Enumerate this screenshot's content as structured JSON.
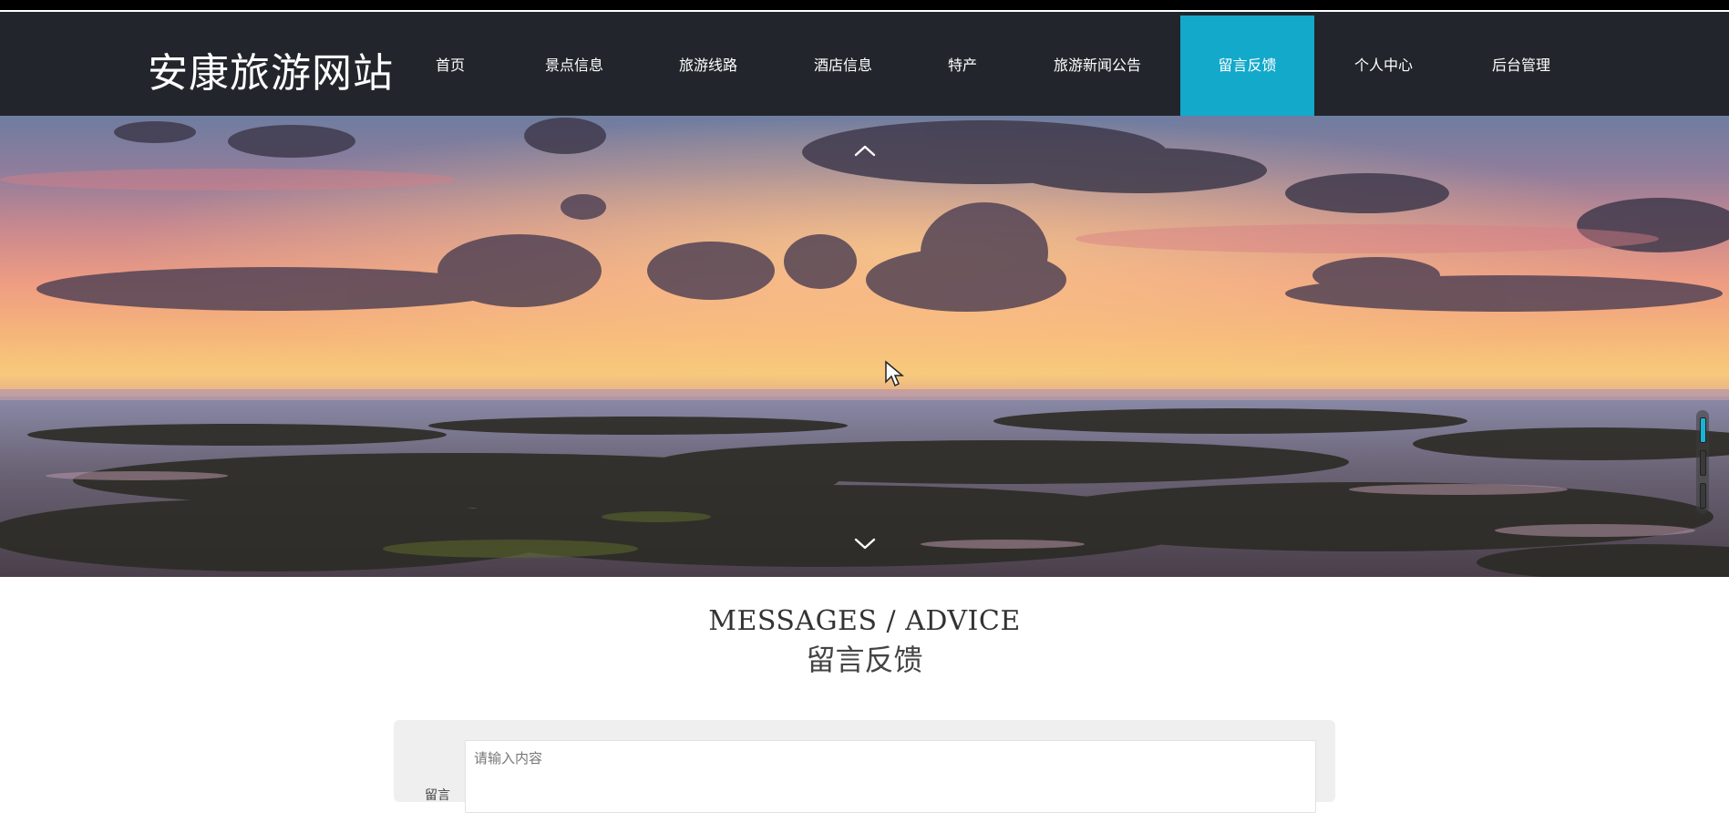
{
  "header": {
    "logo": "安康旅游网站",
    "nav": [
      {
        "label": "首页"
      },
      {
        "label": "景点信息"
      },
      {
        "label": "旅游线路"
      },
      {
        "label": "酒店信息"
      },
      {
        "label": "特产"
      },
      {
        "label": "旅游新闻公告"
      },
      {
        "label": "留言反馈",
        "active": true
      },
      {
        "label": "个人中心"
      },
      {
        "label": "后台管理"
      }
    ]
  },
  "carousel": {
    "slides": 3,
    "active_slide": 1
  },
  "section": {
    "title_en": "MESSAGES / ADVICE",
    "title_zh": "留言反馈"
  },
  "form": {
    "content_placeholder": "请输入内容",
    "content_value": "",
    "content_label": "留言"
  },
  "colors": {
    "nav_bg": "#22262c",
    "nav_active": "#13a9cb",
    "panel_bg": "#efefef"
  }
}
